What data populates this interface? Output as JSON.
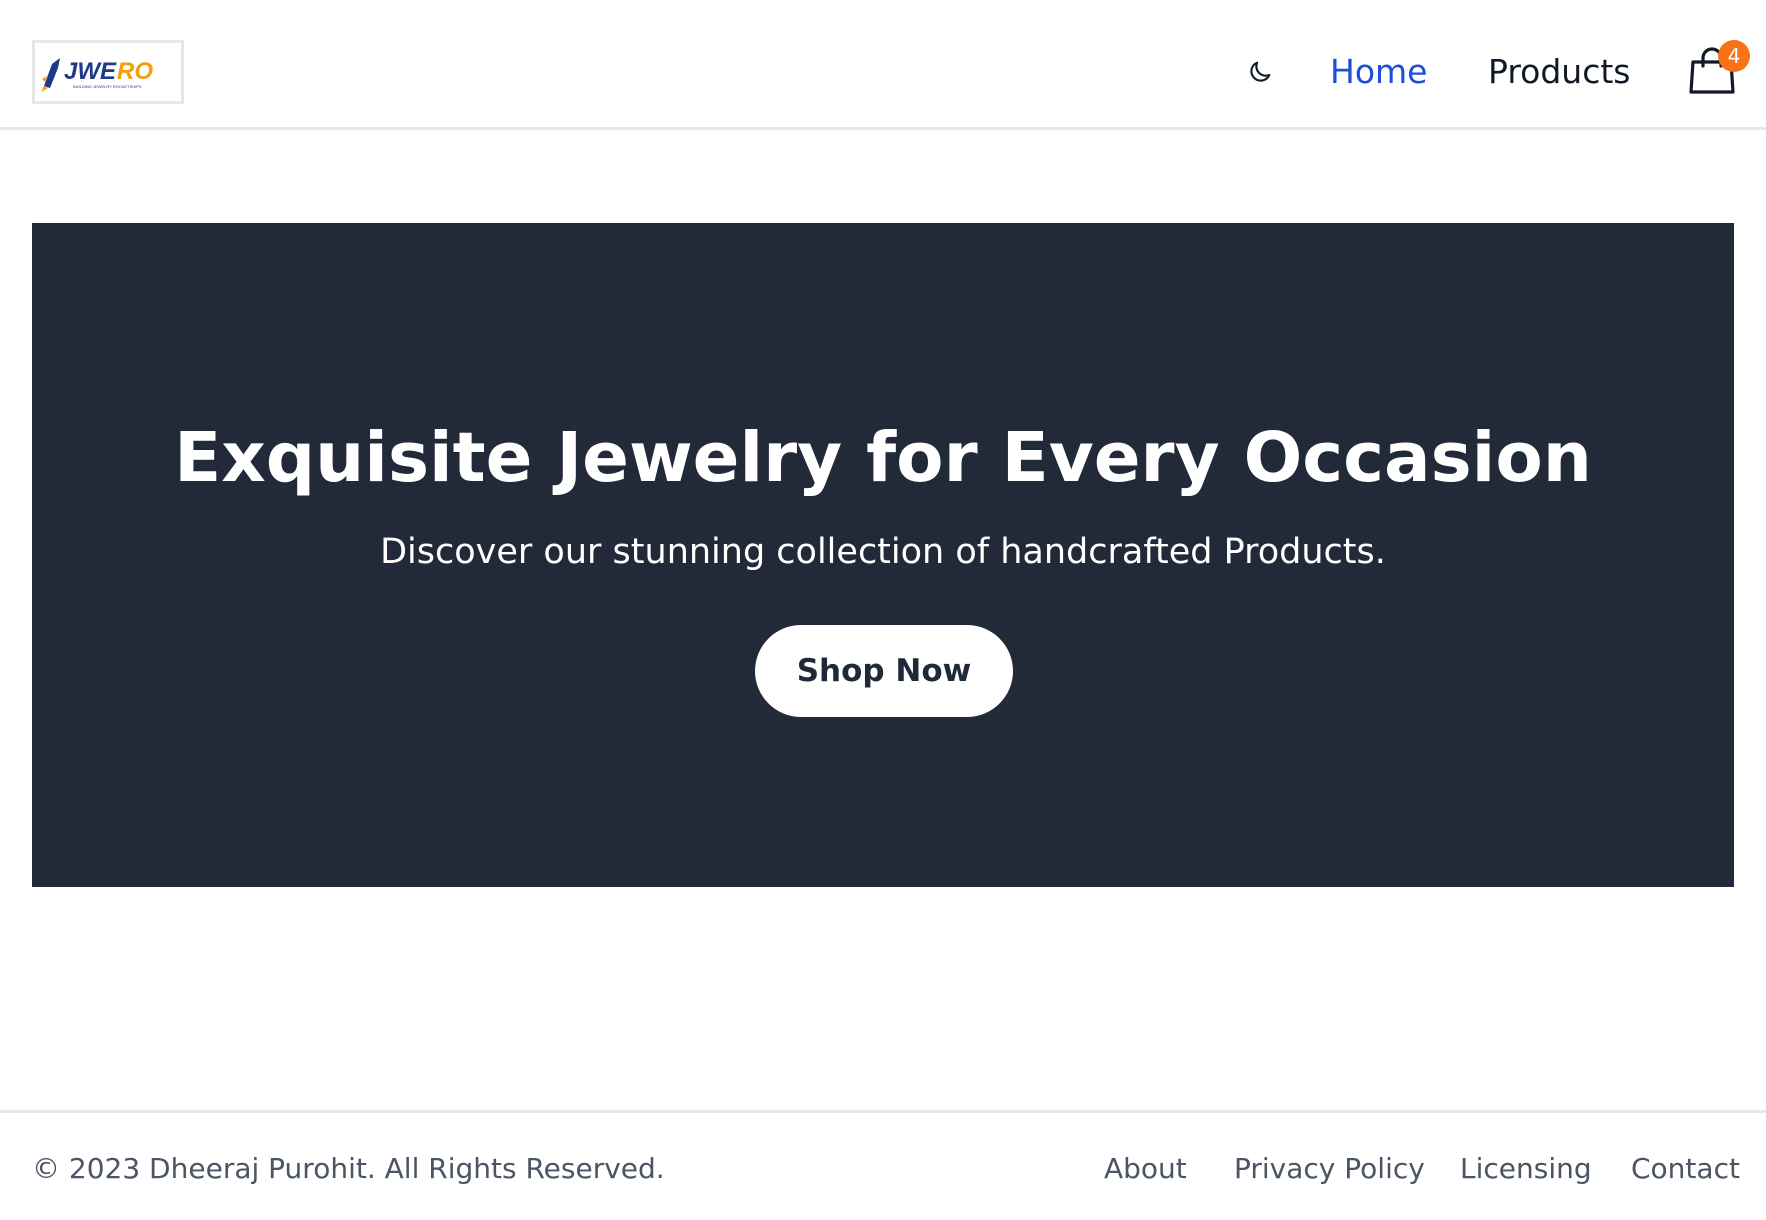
{
  "brand": {
    "logo_text_dark": "JWE",
    "logo_text_accent": "RO",
    "logo_tagline": "BUILDING JEWELRY ROCKETSHIPS",
    "colors": {
      "primary": "#1e3a8a",
      "accent": "#f59e0b"
    }
  },
  "header": {
    "theme_toggle_icon": "moon-icon",
    "nav": [
      {
        "label": "Home",
        "active": true
      },
      {
        "label": "Products",
        "active": false
      }
    ],
    "cart": {
      "icon": "shopping-bag-icon",
      "count": "4"
    }
  },
  "hero": {
    "title": "Exquisite Jewelry for Every Occasion",
    "subtitle": "Discover our stunning collection of handcrafted Products.",
    "cta_label": "Shop Now",
    "background_color": "#222938"
  },
  "footer": {
    "copyright": "© 2023 Dheeraj Purohit. All Rights Reserved.",
    "links": [
      "About",
      "Privacy Policy",
      "Licensing",
      "Contact"
    ]
  },
  "colors": {
    "link_active": "#1d4ed8",
    "badge": "#f97316",
    "text_dark": "#111827",
    "text_muted": "#4b5563",
    "divider": "#e5e7eb"
  }
}
